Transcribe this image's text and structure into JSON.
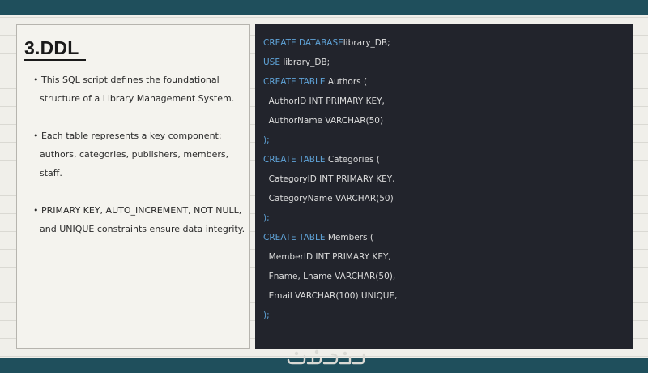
{
  "slide": {
    "title": "3.DDL",
    "bullets": [
      "• This SQL script defines the foundational structure of a Library Management System.",
      "• Each table represents a key component: authors, categories, publishers, members, staff.",
      "• PRIMARY KEY, AUTO_INCREMENT, NOT NULL, and UNIQUE constraints ensure data integrity."
    ]
  },
  "code": {
    "lines": [
      {
        "kw": "CREATE DATABASE",
        "text": "library_DB;"
      },
      {
        "kw": "USE",
        "text": " library_DB;"
      },
      {
        "kw": "CREATE TABLE",
        "text": " Authors ("
      },
      {
        "kw": "",
        "text": "  AuthorID INT PRIMARY KEY,"
      },
      {
        "kw": "",
        "text": "  AuthorName VARCHAR(50)"
      },
      {
        "kw": "",
        "punc": ");"
      },
      {
        "kw": "CREATE TABLE",
        "text": " Categories ("
      },
      {
        "kw": "",
        "text": "  CategoryID INT PRIMARY KEY,"
      },
      {
        "kw": "",
        "text": "  CategoryName VARCHAR(50)"
      },
      {
        "kw": "",
        "punc": ");"
      },
      {
        "kw": "CREATE TABLE",
        "text": " Members ("
      },
      {
        "kw": "",
        "text": "  MemberID INT PRIMARY KEY,"
      },
      {
        "kw": "",
        "text": "  Fname, Lname VARCHAR(50),"
      },
      {
        "kw": "",
        "text": "  Email VARCHAR(100) UNIQUE,"
      },
      {
        "kw": "",
        "punc": ");"
      }
    ]
  },
  "watermark": {
    "icon": "watermark-logo-icon"
  },
  "colors": {
    "frame_bar": "#1f4f5c",
    "code_background": "#22242c",
    "keyword": "#5fa3d8",
    "code_text": "#dcdcdc"
  }
}
